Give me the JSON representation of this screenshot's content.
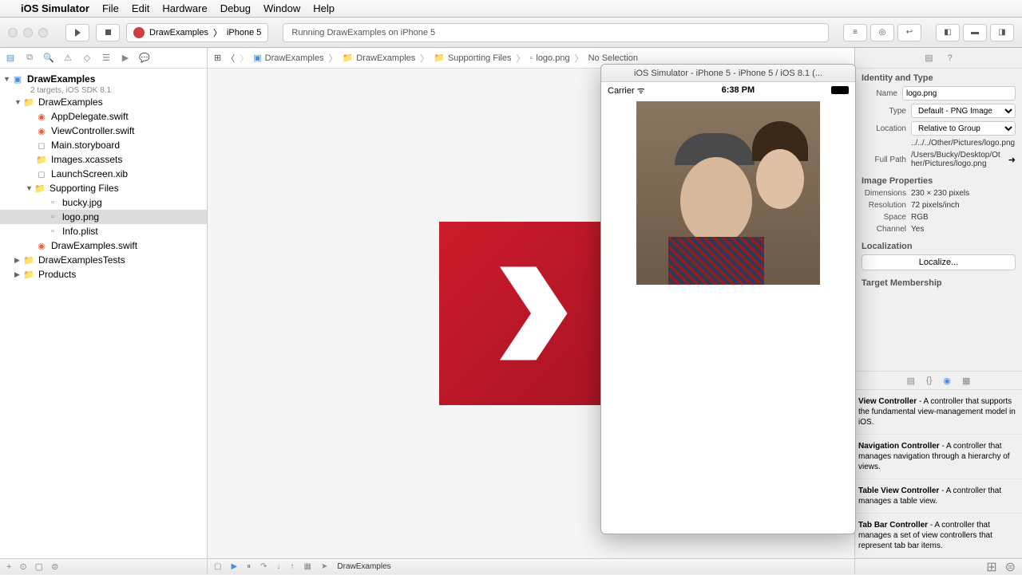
{
  "menubar": {
    "app": "iOS Simulator",
    "items": [
      "File",
      "Edit",
      "Hardware",
      "Debug",
      "Window",
      "Help"
    ]
  },
  "toolbar": {
    "scheme_target": "DrawExamples",
    "scheme_device": "iPhone 5",
    "status": "Running DrawExamples on iPhone 5"
  },
  "navigator": {
    "project": "DrawExamples",
    "subtitle": "2 targets, iOS SDK 8.1",
    "tree": {
      "g1": "DrawExamples",
      "f1": "AppDelegate.swift",
      "f2": "ViewController.swift",
      "f3": "Main.storyboard",
      "f4": "Images.xcassets",
      "f5": "LaunchScreen.xib",
      "g2": "Supporting Files",
      "f6": "bucky.jpg",
      "f7": "logo.png",
      "f8": "Info.plist",
      "f9": "DrawExamples.swift",
      "g3": "DrawExamplesTests",
      "g4": "Products"
    }
  },
  "jumpbar": {
    "p1": "DrawExamples",
    "p2": "DrawExamples",
    "p3": "Supporting Files",
    "p4": "logo.png",
    "p5": "No Selection"
  },
  "inspector": {
    "identity_header": "Identity and Type",
    "name_label": "Name",
    "name_value": "logo.png",
    "type_label": "Type",
    "type_value": "Default - PNG Image",
    "location_label": "Location",
    "location_value": "Relative to Group",
    "rel_path": "../../../Other/Pictures/logo.png",
    "fullpath_label": "Full Path",
    "fullpath_value": "/Users/Bucky/Desktop/Other/Pictures/logo.png",
    "props_header": "Image Properties",
    "dim_label": "Dimensions",
    "dim_value": "230 × 230 pixels",
    "res_label": "Resolution",
    "res_value": "72 pixels/inch",
    "space_label": "Space",
    "space_value": "RGB",
    "channel_label": "Channel",
    "channel_value": "Yes",
    "loc_header": "Localization",
    "loc_button": "Localize...",
    "tm_header": "Target Membership",
    "lib": {
      "i1t": "View Controller",
      "i1d": " - A controller that supports the fundamental view-management model in iOS.",
      "i2t": "Navigation Controller",
      "i2d": " - A controller that manages navigation through a hierarchy of views.",
      "i3t": "Table View Controller",
      "i3d": " - A controller that manages a table view.",
      "i4t": "Tab Bar Controller",
      "i4d": " - A controller that manages a set of view controllers that represent tab bar items."
    }
  },
  "simulator": {
    "title": "iOS Simulator - iPhone 5 - iPhone 5 / iOS 8.1 (...",
    "carrier": "Carrier",
    "time": "6:38 PM"
  },
  "debugbar": {
    "target": "DrawExamples"
  }
}
